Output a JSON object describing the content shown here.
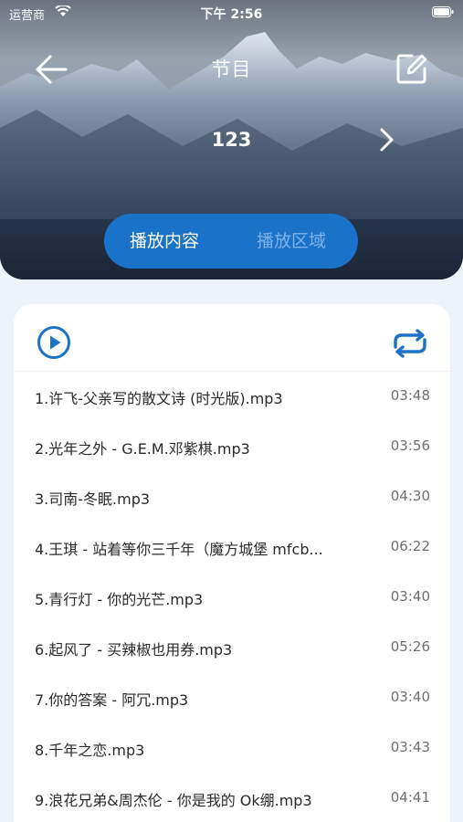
{
  "status_bar": {
    "carrier": "运营商",
    "time": "下午 2:56"
  },
  "header": {
    "title": "节目",
    "program_name": "123"
  },
  "segment": {
    "options": [
      "播放内容",
      "播放区域"
    ],
    "selected": "播放内容"
  },
  "colors": {
    "accent": "#1a73c9",
    "inactive_segment_text": "#7fb0e8",
    "page_background": "#eef2f9"
  },
  "icons": {
    "back": "arrow-left-icon",
    "edit": "edit-icon",
    "next": "chevron-right-icon",
    "play": "play-circle-icon",
    "loop": "repeat-icon"
  },
  "tracks": [
    {
      "name": "1.许飞-父亲写的散文诗 (时光版).mp3",
      "duration": "03:48"
    },
    {
      "name": "2.光年之外 - G.E.M.邓紫棋.mp3",
      "duration": "03:56"
    },
    {
      "name": "3.司南-冬眠.mp3",
      "duration": "04:30"
    },
    {
      "name": "4.王琪 - 站着等你三千年（魔方城堡 mfcb...",
      "duration": "06:22"
    },
    {
      "name": "5.青行灯 - 你的光芒.mp3",
      "duration": "03:40"
    },
    {
      "name": "6.起风了 - 买辣椒也用券.mp3",
      "duration": "05:26"
    },
    {
      "name": "7.你的答案 - 阿冗.mp3",
      "duration": "03:40"
    },
    {
      "name": "8.千年之恋.mp3",
      "duration": "03:43"
    },
    {
      "name": "9.浪花兄弟&周杰伦 - 你是我的 Ok绷.mp3",
      "duration": "04:41"
    }
  ]
}
